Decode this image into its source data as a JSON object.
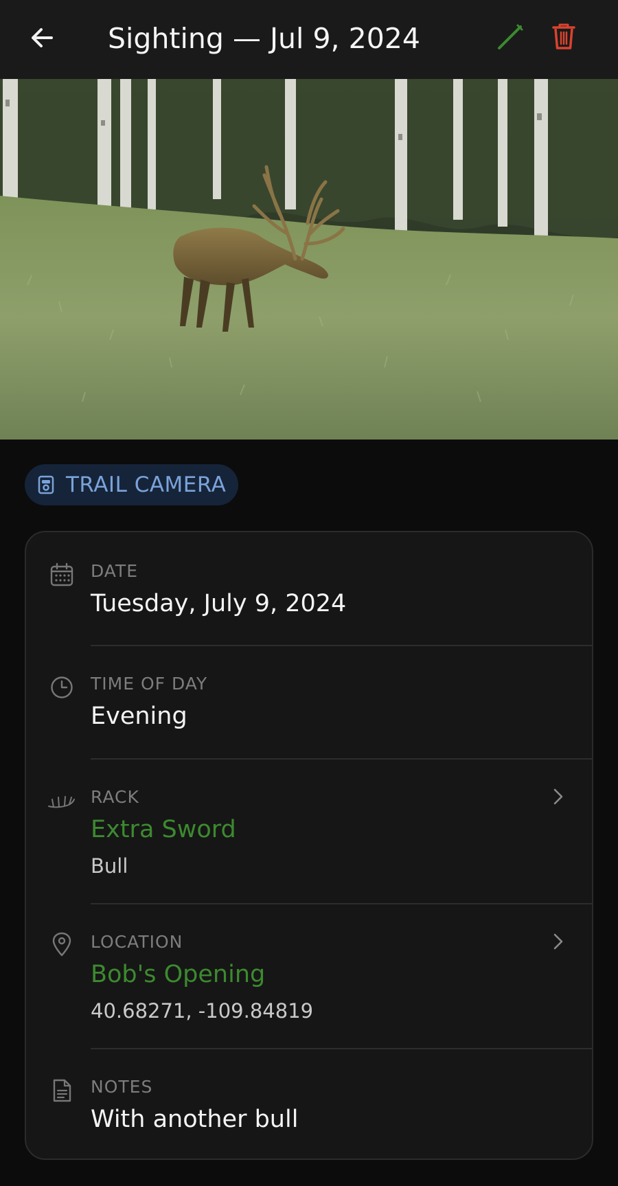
{
  "header": {
    "title": "Sighting — Jul 9, 2024",
    "back_icon": "arrow-left-icon",
    "edit_icon": "pencil-icon",
    "delete_icon": "trash-icon"
  },
  "photo": {
    "subject": "Bull elk with velvet antlers grazing in a meadow beside aspen trees"
  },
  "source_chip": {
    "label": "TRAIL CAMERA",
    "icon": "trail-camera-icon"
  },
  "details": {
    "date": {
      "label": "DATE",
      "value": "Tuesday, July 9, 2024",
      "icon": "calendar-icon"
    },
    "time": {
      "label": "TIME OF DAY",
      "value": "Evening",
      "icon": "clock-icon"
    },
    "rack": {
      "label": "RACK",
      "value": "Extra Sword",
      "sub": "Bull",
      "icon": "antler-icon"
    },
    "location": {
      "label": "LOCATION",
      "value": "Bob's Opening",
      "sub": "40.68271, -109.84819",
      "icon": "map-pin-icon"
    },
    "notes": {
      "label": "NOTES",
      "value": "With another bull",
      "icon": "document-icon"
    }
  },
  "colors": {
    "accent_green": "#3c8a2f",
    "delete_red": "#d9432f",
    "chip_blue": "#7aa3d9",
    "background": "#0c0c0c",
    "card": "#161616"
  }
}
